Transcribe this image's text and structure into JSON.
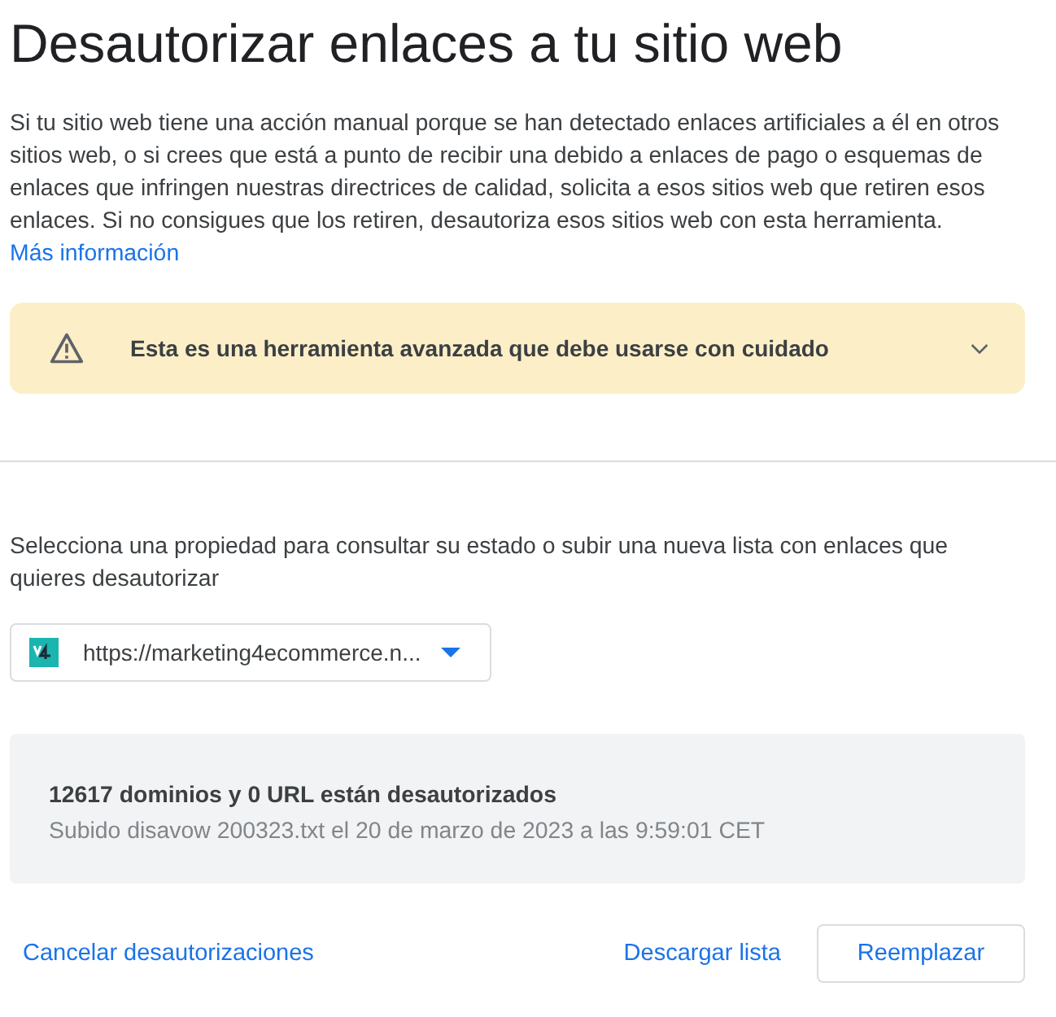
{
  "title": "Desautorizar enlaces a tu sitio web",
  "intro": {
    "text": "Si tu sitio web tiene una acción manual porque se han detectado enlaces artificiales a él en otros sitios web, o si crees que está a punto de recibir una debido a enlaces de pago o esquemas de enlaces que infringen nuestras directrices de calidad, solicita a esos sitios web que retiren esos enlaces. Si no consigues que los retiren, desautoriza esos sitios web con esta herramienta.",
    "link": "Más información"
  },
  "warning": {
    "text": "Esta es una herramienta avanzada que debe usarse con cuidado",
    "expanded": false
  },
  "property": {
    "prompt": "Selecciona una propiedad para consultar su estado o subir una nueva lista con enlaces que quieres desautorizar",
    "value": "https://marketing4ecommerce.n..."
  },
  "status": {
    "summary": "12617 dominios y 0 URL están desautorizados",
    "detail": "Subido disavow 200323.txt el 20 de marzo de 2023 a las 9:59:01 CET"
  },
  "actions": [
    {
      "label": "Cancelar desautorizaciones",
      "kind": "link"
    },
    {
      "label": "Descargar lista",
      "kind": "link"
    },
    {
      "label": "Reemplazar",
      "kind": "outlined"
    }
  ]
}
